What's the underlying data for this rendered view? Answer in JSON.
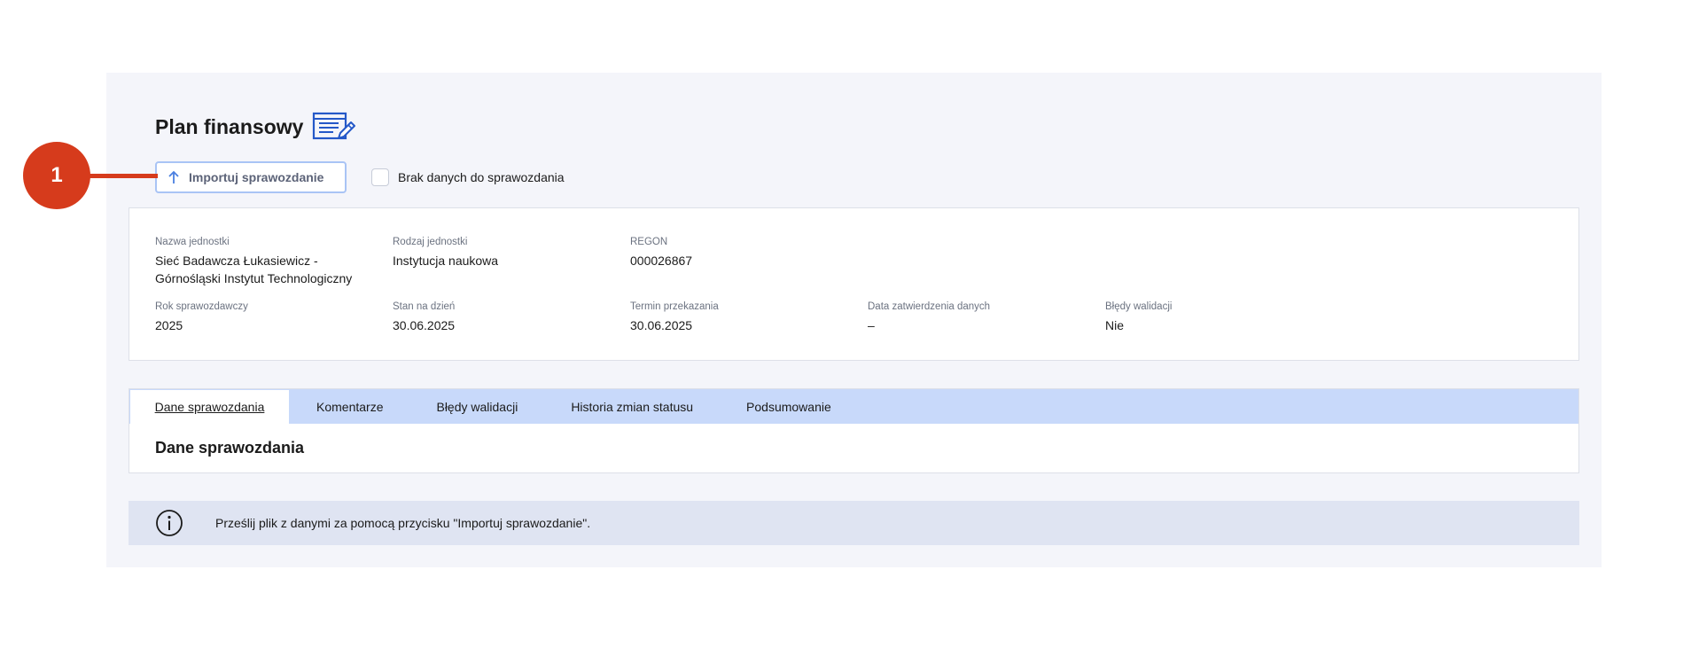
{
  "page": {
    "title": "Plan finansowy",
    "title_icon": "document-edit-icon"
  },
  "actions": {
    "import_label": "Importuj sprawozdanie",
    "import_icon": "arrow-up-icon",
    "no_data_label": "Brak danych do sprawozdania",
    "no_data_checked": false
  },
  "info": {
    "nazwa_label": "Nazwa jednostki",
    "nazwa_value_line1": "Sieć Badawcza Łukasiewicz -",
    "nazwa_value_line2": "Górnośląski Instytut Technologiczny",
    "rodzaj_label": "Rodzaj jednostki",
    "rodzaj_value": "Instytucja naukowa",
    "regon_label": "REGON",
    "regon_value": "000026867",
    "rok_label": "Rok sprawozdawczy",
    "rok_value": "2025",
    "stan_label": "Stan na dzień",
    "stan_value": "30.06.2025",
    "termin_label": "Termin przekazania",
    "termin_value": "30.06.2025",
    "data_zatw_label": "Data zatwierdzenia danych",
    "data_zatw_value": "–",
    "bledy_label": "Błędy walidacji",
    "bledy_value": "Nie"
  },
  "tabs": [
    {
      "label": "Dane sprawozdania",
      "active": true
    },
    {
      "label": "Komentarze",
      "active": false
    },
    {
      "label": "Błędy walidacji",
      "active": false
    },
    {
      "label": "Historia zmian statusu",
      "active": false
    },
    {
      "label": "Podsumowanie",
      "active": false
    }
  ],
  "section": {
    "title": "Dane sprawozdania"
  },
  "notice": {
    "icon": "info-icon",
    "text": "Prześlij plik z danymi za pomocą przycisku \"Importuj sprawozdanie\"."
  },
  "annotation": {
    "number": "1"
  },
  "colors": {
    "accent_border": "#a9c4f5",
    "tab_bar": "#c8d9fa",
    "panel_bg": "#f4f5fa",
    "notice_bg": "#dfe4f2",
    "marker": "#d63b1c",
    "icon_blue": "#2458c8"
  }
}
